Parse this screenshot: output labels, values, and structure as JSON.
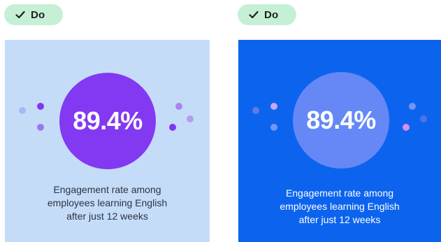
{
  "left_example": {
    "badge": {
      "label": "Do",
      "icon": "check-icon"
    },
    "stat": {
      "value": "89.4%",
      "caption_lines": [
        "Engagement rate among",
        "employees learning English",
        "after just 12 weeks"
      ]
    },
    "colors": {
      "panel_background": "#c5dcf8",
      "circle": "#8239f1",
      "caption": "#2b3345"
    }
  },
  "right_example": {
    "badge": {
      "label": "Do",
      "icon": "check-icon"
    },
    "stat": {
      "value": "89.4%",
      "caption_lines": [
        "Engagement rate among",
        "employees learning English",
        "after just 12 weeks"
      ]
    },
    "colors": {
      "panel_background": "#0c64ee",
      "circle": "#6588f6",
      "caption": "#ffffff"
    }
  },
  "badge_colors": {
    "background": "#c6f0d6",
    "text": "#1e1e1e"
  }
}
